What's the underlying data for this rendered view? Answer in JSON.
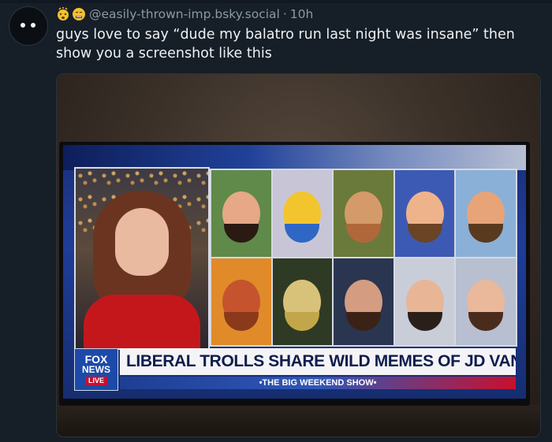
{
  "post": {
    "handle": "@easily-thrown-imp.bsky.social",
    "separator": "·",
    "time": "10h",
    "text": "guys love to say “dude my balatro run last night was insane” then show you a screenshot like this",
    "emoji_icons": [
      "dizzy-face-emoji-icon",
      "steaming-face-emoji-icon"
    ]
  },
  "tv": {
    "logo_line1": "FOX",
    "logo_line2": "NEWS",
    "logo_badge": "LIVE",
    "headline": "LIBERAL TROLLS SHARE WILD MEMES OF JD VANCE",
    "show_name": "•THE BIG WEEKEND SHOW•"
  },
  "colors": {
    "background": "#161e27",
    "text": "#eef1f4",
    "muted": "#8b98a5",
    "fox_blue": "#1d4aa8",
    "fox_red": "#c8102e"
  }
}
